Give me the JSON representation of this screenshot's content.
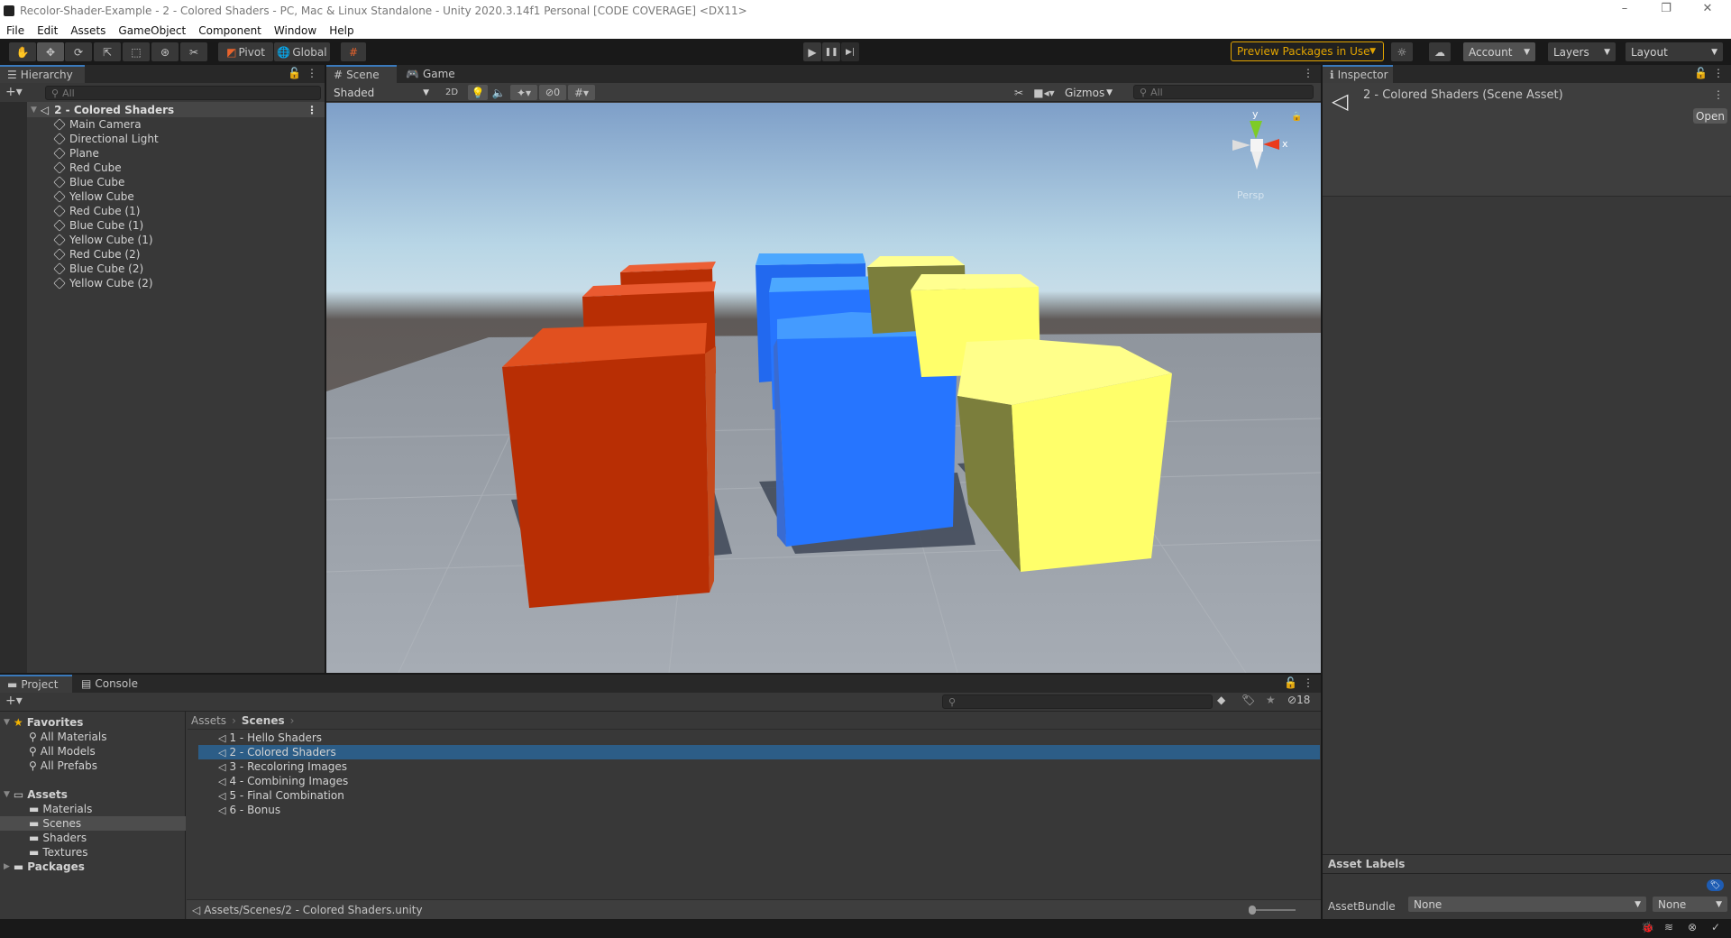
{
  "window": {
    "title": "Recolor-Shader-Example - 2 - Colored Shaders - PC, Mac & Linux Standalone - Unity 2020.3.14f1 Personal [CODE COVERAGE] <DX11>",
    "controls": {
      "minimize": "–",
      "restore": "❐",
      "close": "✕"
    }
  },
  "menu": [
    "File",
    "Edit",
    "Assets",
    "GameObject",
    "Component",
    "Window",
    "Help"
  ],
  "toolbar": {
    "tools": [
      {
        "name": "hand-tool",
        "glyph": "✋"
      },
      {
        "name": "move-tool",
        "glyph": "✥"
      },
      {
        "name": "rotate-tool",
        "glyph": "⟳"
      },
      {
        "name": "scale-tool",
        "glyph": "⇱"
      },
      {
        "name": "rect-tool",
        "glyph": "⬚"
      },
      {
        "name": "transform-tool",
        "glyph": "⊛"
      },
      {
        "name": "custom-tool",
        "glyph": "✂"
      }
    ],
    "pivot_label": "Pivot",
    "global_label": "Global",
    "play": "▶",
    "pause": "❚❚",
    "step": "▶|",
    "preview_packages": "Preview Packages in Use",
    "account": "Account",
    "layers": "Layers",
    "layout": "Layout"
  },
  "hierarchy": {
    "tab": "Hierarchy",
    "search_placeholder": "All",
    "scene": "2 - Colored Shaders",
    "items": [
      "Main Camera",
      "Directional Light",
      "Plane",
      "Red Cube",
      "Blue Cube",
      "Yellow Cube",
      "Red Cube (1)",
      "Blue Cube (1)",
      "Yellow Cube (1)",
      "Red Cube (2)",
      "Blue Cube (2)",
      "Yellow Cube (2)"
    ]
  },
  "scene_view": {
    "tabs": [
      "Scene",
      "Game"
    ],
    "shading_mode": "Shaded",
    "mode_2d": "2D",
    "hidden_count": "0",
    "gizmos": "Gizmos",
    "search_placeholder": "All",
    "projection": "Persp",
    "axis_x": "x",
    "axis_y": "y"
  },
  "inspector": {
    "tab": "Inspector",
    "asset_title": "2 - Colored Shaders (Scene Asset)",
    "open_button": "Open",
    "asset_labels": "Asset Labels",
    "assetbundle_label": "AssetBundle",
    "assetbundle_value": "None",
    "assetbundle_variant": "None"
  },
  "project": {
    "tabs": [
      "Project",
      "Console"
    ],
    "favorites_label": "Favorites",
    "favorites": [
      "All Materials",
      "All Models",
      "All Prefabs"
    ],
    "assets_label": "Assets",
    "folders": [
      "Materials",
      "Scenes",
      "Shaders",
      "Textures"
    ],
    "packages_label": "Packages",
    "breadcrumb": [
      "Assets",
      "Scenes"
    ],
    "scenes": [
      "1 - Hello Shaders",
      "2 - Colored Shaders",
      "3 - Recoloring Images",
      "4 - Combining Images",
      "5 - Final Combination",
      "6 - Bonus"
    ],
    "selected_scene": "2 - Colored Shaders",
    "hidden_packages_count": "18",
    "footer_path": "Assets/Scenes/2 - Colored Shaders.unity",
    "zoom_slider": 0.0
  },
  "colors": {
    "accent": "#2c5d87",
    "preview_badge": "#e2a400",
    "red_cube": "#b82e04",
    "blue_cube": "#2675ff",
    "yellow_cube": "#ffff6a"
  }
}
